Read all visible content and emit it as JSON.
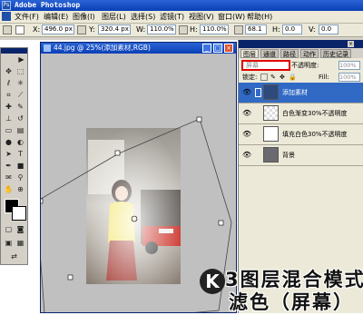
{
  "app": {
    "title": "Adobe Photoshop",
    "icon": "photoshop-icon"
  },
  "menu": {
    "items": [
      "文件(F)",
      "编辑(E)",
      "图像(I)",
      "图层(L)",
      "选择(S)",
      "滤镜(T)",
      "视图(V)",
      "窗口(W)",
      "帮助(H)"
    ]
  },
  "options": {
    "x_label": "X:",
    "x_value": "496.0 px",
    "y_label": "Y:",
    "y_value": "320.4 px",
    "w_label": "W:",
    "w_value": "110.0%",
    "h_label": "H:",
    "h_value": "110.0%",
    "angle_value": "68.1",
    "h_skew_label": "H:",
    "h_skew_value": "0.0",
    "v_skew_label": "V:",
    "v_skew_value": "0.0"
  },
  "document": {
    "title": "44.jpg @ 25%(添加素材,RGB)"
  },
  "layers_panel": {
    "tabs": [
      "图层",
      "通道",
      "路径",
      "动作",
      "历史记录"
    ],
    "blend_mode": "屏幕",
    "opacity_label": "不透明度:",
    "opacity_value": "100%",
    "lock_label": "锁定:",
    "fill_label": "Fill:",
    "fill_value": "100%",
    "layers": [
      {
        "name": "添加素材",
        "selected": true
      },
      {
        "name": "白色渐变30%不透明度",
        "selected": false
      },
      {
        "name": "填充白色30%不透明度",
        "selected": false
      },
      {
        "name": "背景",
        "selected": false
      }
    ]
  },
  "watermark": {
    "letter": "K",
    "line1": "3图层混合模式",
    "line2": "滤色（屏幕）"
  },
  "colors": {
    "accent": "#316ac5",
    "highlight_red": "#e00000"
  }
}
